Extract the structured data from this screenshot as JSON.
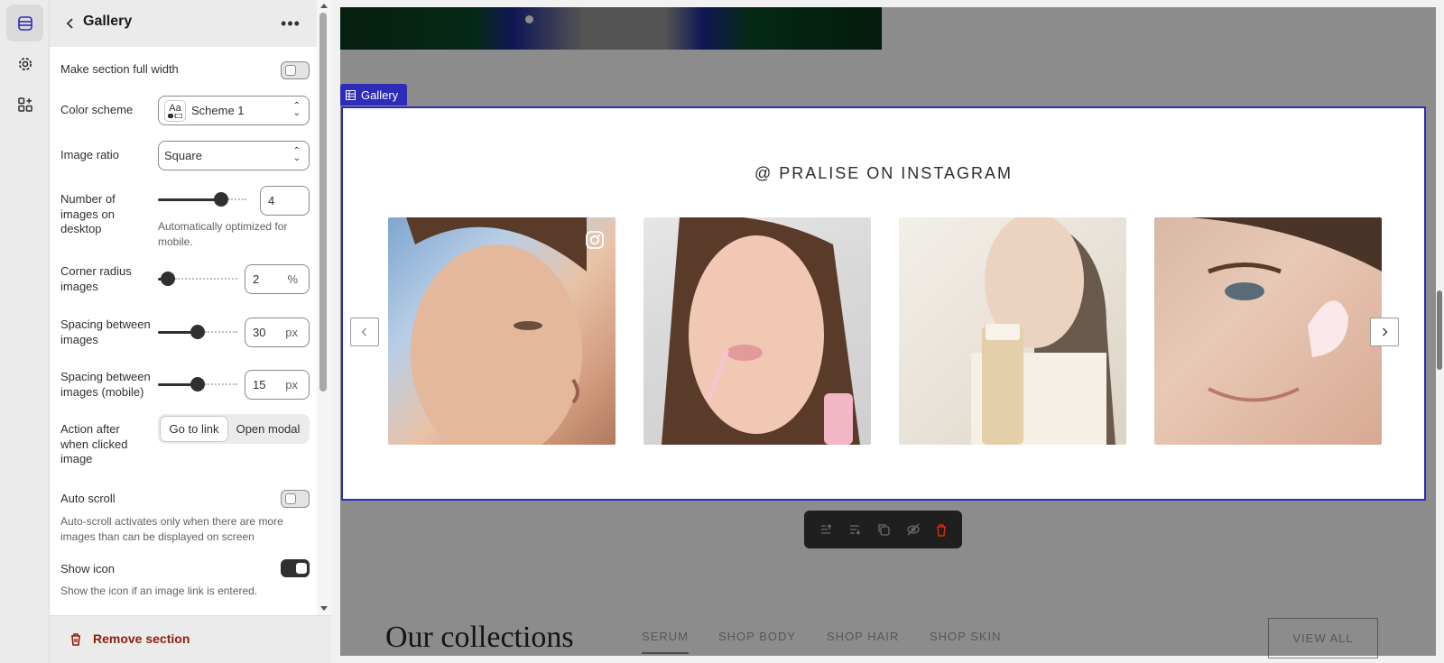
{
  "rail": {
    "items": [
      {
        "name": "sections-icon",
        "active": true
      },
      {
        "name": "settings-icon",
        "active": false
      },
      {
        "name": "apps-icon",
        "active": false
      }
    ]
  },
  "panel": {
    "title": "Gallery",
    "more_label": "•••",
    "full_width": {
      "label": "Make section full width",
      "on": false
    },
    "color_scheme": {
      "label": "Color scheme",
      "value": "Scheme 1",
      "icon_text": "Aa"
    },
    "image_ratio": {
      "label": "Image ratio",
      "value": "Square"
    },
    "images_desktop": {
      "label": "Number of images on desktop",
      "value": "4",
      "level": 0.75,
      "helper": "Automatically optimized for mobile."
    },
    "corner_radius": {
      "label": "Corner radius images",
      "value": "2",
      "unit": "%",
      "level": 0.04
    },
    "spacing": {
      "label": "Spacing between images",
      "value": "30",
      "unit": "px",
      "level": 0.5
    },
    "spacing_mobile": {
      "label": "Spacing between images (mobile)",
      "value": "15",
      "unit": "px",
      "level": 0.5
    },
    "action": {
      "label": "Action after when clicked image",
      "options": [
        "Go to link",
        "Open modal"
      ],
      "selected": "Go to link"
    },
    "auto_scroll": {
      "label": "Auto scroll",
      "on": false,
      "helper": "Auto-scroll activates only when there are more images than can be displayed on screen"
    },
    "show_icon": {
      "label": "Show icon",
      "on": true,
      "helper": "Show the icon if an image link is entered."
    },
    "remove_label": "Remove section"
  },
  "preview": {
    "section_tag": "Gallery",
    "gallery_heading": "@ PRALISE ON INSTAGRAM",
    "images": [
      {
        "name": "gallery-image-freckled-face",
        "has_icon": true
      },
      {
        "name": "gallery-image-lip-gloss",
        "has_icon": false
      },
      {
        "name": "gallery-image-serum-bottle",
        "has_icon": false
      },
      {
        "name": "gallery-image-cream-cheek",
        "has_icon": false
      }
    ],
    "collections_title": "Our collections",
    "collection_tabs": [
      "SERUM",
      "SHOP BODY",
      "SHOP HAIR",
      "SHOP SKIN"
    ],
    "view_all": "VIEW ALL"
  },
  "colors": {
    "accent": "#2c2cb8",
    "delete": "#d72c0d",
    "panel_bg": "#ffffff",
    "rail_bg": "#ebebeb"
  }
}
